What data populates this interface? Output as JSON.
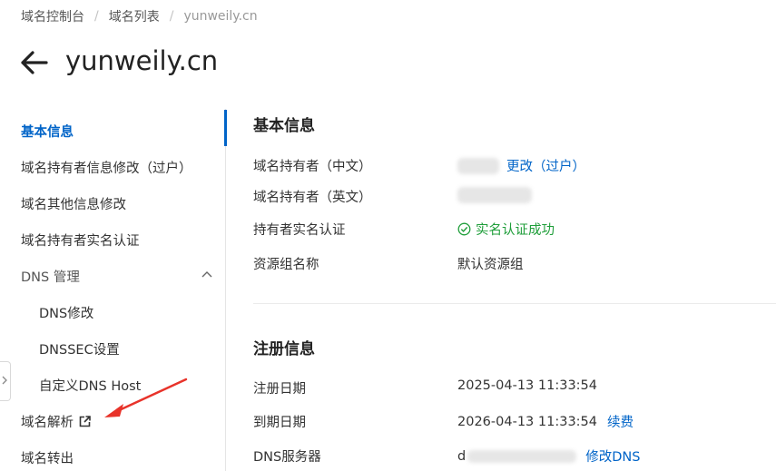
{
  "breadcrumb": {
    "items": [
      "域名控制台",
      "域名列表",
      "yunweily.cn"
    ]
  },
  "header": {
    "title": "yunweily.cn",
    "back_icon": "arrow-left-icon"
  },
  "sidebar": {
    "items": [
      {
        "label": "基本信息"
      },
      {
        "label": "域名持有者信息修改（过户）"
      },
      {
        "label": "域名其他信息修改"
      },
      {
        "label": "域名持有者实名认证"
      },
      {
        "label": "DNS 管理"
      },
      {
        "label": "DNS修改"
      },
      {
        "label": "DNSSEC设置"
      },
      {
        "label": "自定义DNS Host"
      },
      {
        "label": "域名解析"
      },
      {
        "label": "域名转出"
      }
    ]
  },
  "basic_info": {
    "title": "基本信息",
    "rows": [
      {
        "label": "域名持有者（中文）",
        "link": "更改（过户）"
      },
      {
        "label": "域名持有者（英文）"
      },
      {
        "label": "持有者实名认证",
        "value": "实名认证成功"
      },
      {
        "label": "资源组名称",
        "value": "默认资源组"
      }
    ]
  },
  "registration_info": {
    "title": "注册信息",
    "rows": [
      {
        "label": "注册日期",
        "value": "2025-04-13 11:33:54"
      },
      {
        "label": "到期日期",
        "value": "2026-04-13 11:33:54",
        "link": "续费"
      },
      {
        "label": "DNS服务器",
        "value": "d",
        "link": "修改DNS"
      }
    ]
  },
  "colors": {
    "accent": "#0064c8",
    "success": "#1f9e3a",
    "annotation_arrow": "#e8332a"
  }
}
